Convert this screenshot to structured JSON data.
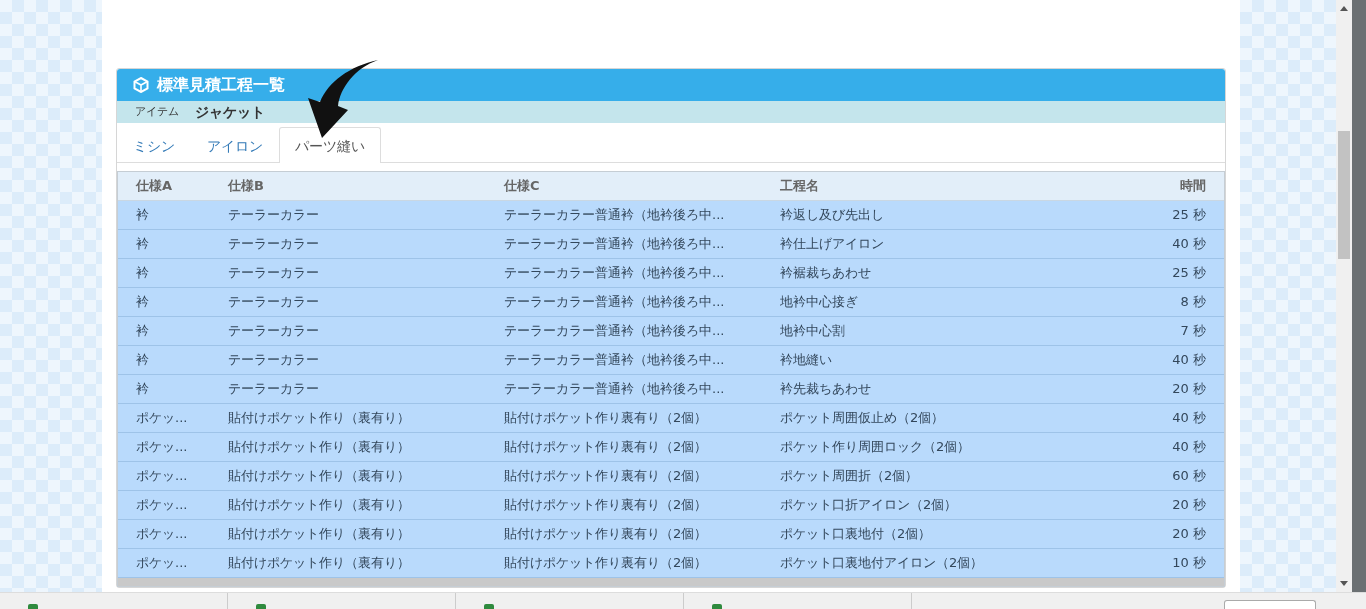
{
  "panel": {
    "title": "標準見積工程一覧",
    "item_label": "アイテム",
    "item_value": "ジャケット"
  },
  "tabs": [
    {
      "label": "ミシン",
      "selected": false
    },
    {
      "label": "アイロン",
      "selected": false
    },
    {
      "label": "パーツ縫い",
      "selected": true
    }
  ],
  "table": {
    "columns": [
      "仕様A",
      "仕様B",
      "仕様C",
      "工程名",
      "時間"
    ],
    "rows": [
      {
        "cells": [
          "衿",
          "テーラーカラー",
          "テーラーカラー普通衿（地衿後ろ中...",
          "衿返し及び先出し",
          "25 秒"
        ],
        "selected": true
      },
      {
        "cells": [
          "衿",
          "テーラーカラー",
          "テーラーカラー普通衿（地衿後ろ中...",
          "衿仕上げアイロン",
          "40 秒"
        ],
        "selected": true
      },
      {
        "cells": [
          "衿",
          "テーラーカラー",
          "テーラーカラー普通衿（地衿後ろ中...",
          "衿裾裁ちあわせ",
          "25 秒"
        ],
        "selected": true
      },
      {
        "cells": [
          "衿",
          "テーラーカラー",
          "テーラーカラー普通衿（地衿後ろ中...",
          "地衿中心接ぎ",
          "8 秒"
        ],
        "selected": true
      },
      {
        "cells": [
          "衿",
          "テーラーカラー",
          "テーラーカラー普通衿（地衿後ろ中...",
          "地衿中心割",
          "7 秒"
        ],
        "selected": true
      },
      {
        "cells": [
          "衿",
          "テーラーカラー",
          "テーラーカラー普通衿（地衿後ろ中...",
          "衿地縫い",
          "40 秒"
        ],
        "selected": true
      },
      {
        "cells": [
          "衿",
          "テーラーカラー",
          "テーラーカラー普通衿（地衿後ろ中...",
          "衿先裁ちあわせ",
          "20 秒"
        ],
        "selected": true
      },
      {
        "cells": [
          "ポケッ...",
          "貼付けポケット作り（裏有り）",
          "貼付けポケット作り裏有り（2個）",
          "ポケット周囲仮止め（2個）",
          "40 秒"
        ],
        "selected": true
      },
      {
        "cells": [
          "ポケッ...",
          "貼付けポケット作り（裏有り）",
          "貼付けポケット作り裏有り（2個）",
          "ポケット作り周囲ロック（2個）",
          "40 秒"
        ],
        "selected": true
      },
      {
        "cells": [
          "ポケッ...",
          "貼付けポケット作り（裏有り）",
          "貼付けポケット作り裏有り（2個）",
          "ポケット周囲折（2個）",
          "60 秒"
        ],
        "selected": true
      },
      {
        "cells": [
          "ポケッ...",
          "貼付けポケット作り（裏有り）",
          "貼付けポケット作り裏有り（2個）",
          "ポケット口折アイロン（2個）",
          "20 秒"
        ],
        "selected": true
      },
      {
        "cells": [
          "ポケッ...",
          "貼付けポケット作り（裏有り）",
          "貼付けポケット作り裏有り（2個）",
          "ポケット口裏地付（2個）",
          "20 秒"
        ],
        "selected": true
      },
      {
        "cells": [
          "ポケッ...",
          "貼付けポケット作り（裏有り）",
          "貼付けポケット作り裏有り（2個）",
          "ポケット口裏地付アイロン（2個）",
          "10 秒"
        ],
        "selected": true
      }
    ]
  }
}
